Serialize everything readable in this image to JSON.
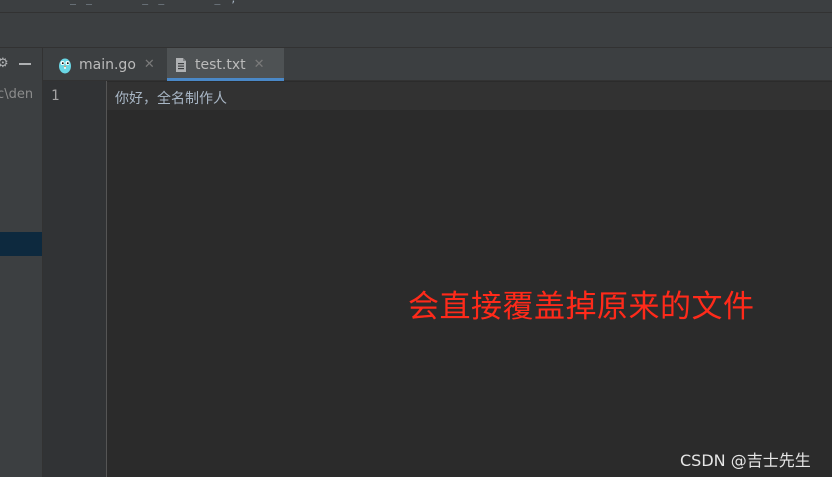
{
  "editor_tabs": [
    {
      "label": "main.go",
      "icon": "gopher-icon",
      "active": false
    },
    {
      "label": "test.txt",
      "icon": "text-file-icon",
      "active": true
    }
  ],
  "project_panel": {
    "path_fragment": "rc\\den"
  },
  "editor": {
    "line_numbers": [
      "1"
    ],
    "lines": [
      "你好，全名制作人"
    ]
  },
  "annotation": {
    "text": "会直接覆盖掉原来的文件",
    "color": "#ff2a1a"
  },
  "watermark": {
    "text": "CSDN @吉士先生"
  },
  "colors": {
    "editor_bg": "#2b2b2b",
    "panel_bg": "#3c3f41",
    "tab_active_underline": "#4a88c7",
    "selection": "#0d293e"
  }
}
